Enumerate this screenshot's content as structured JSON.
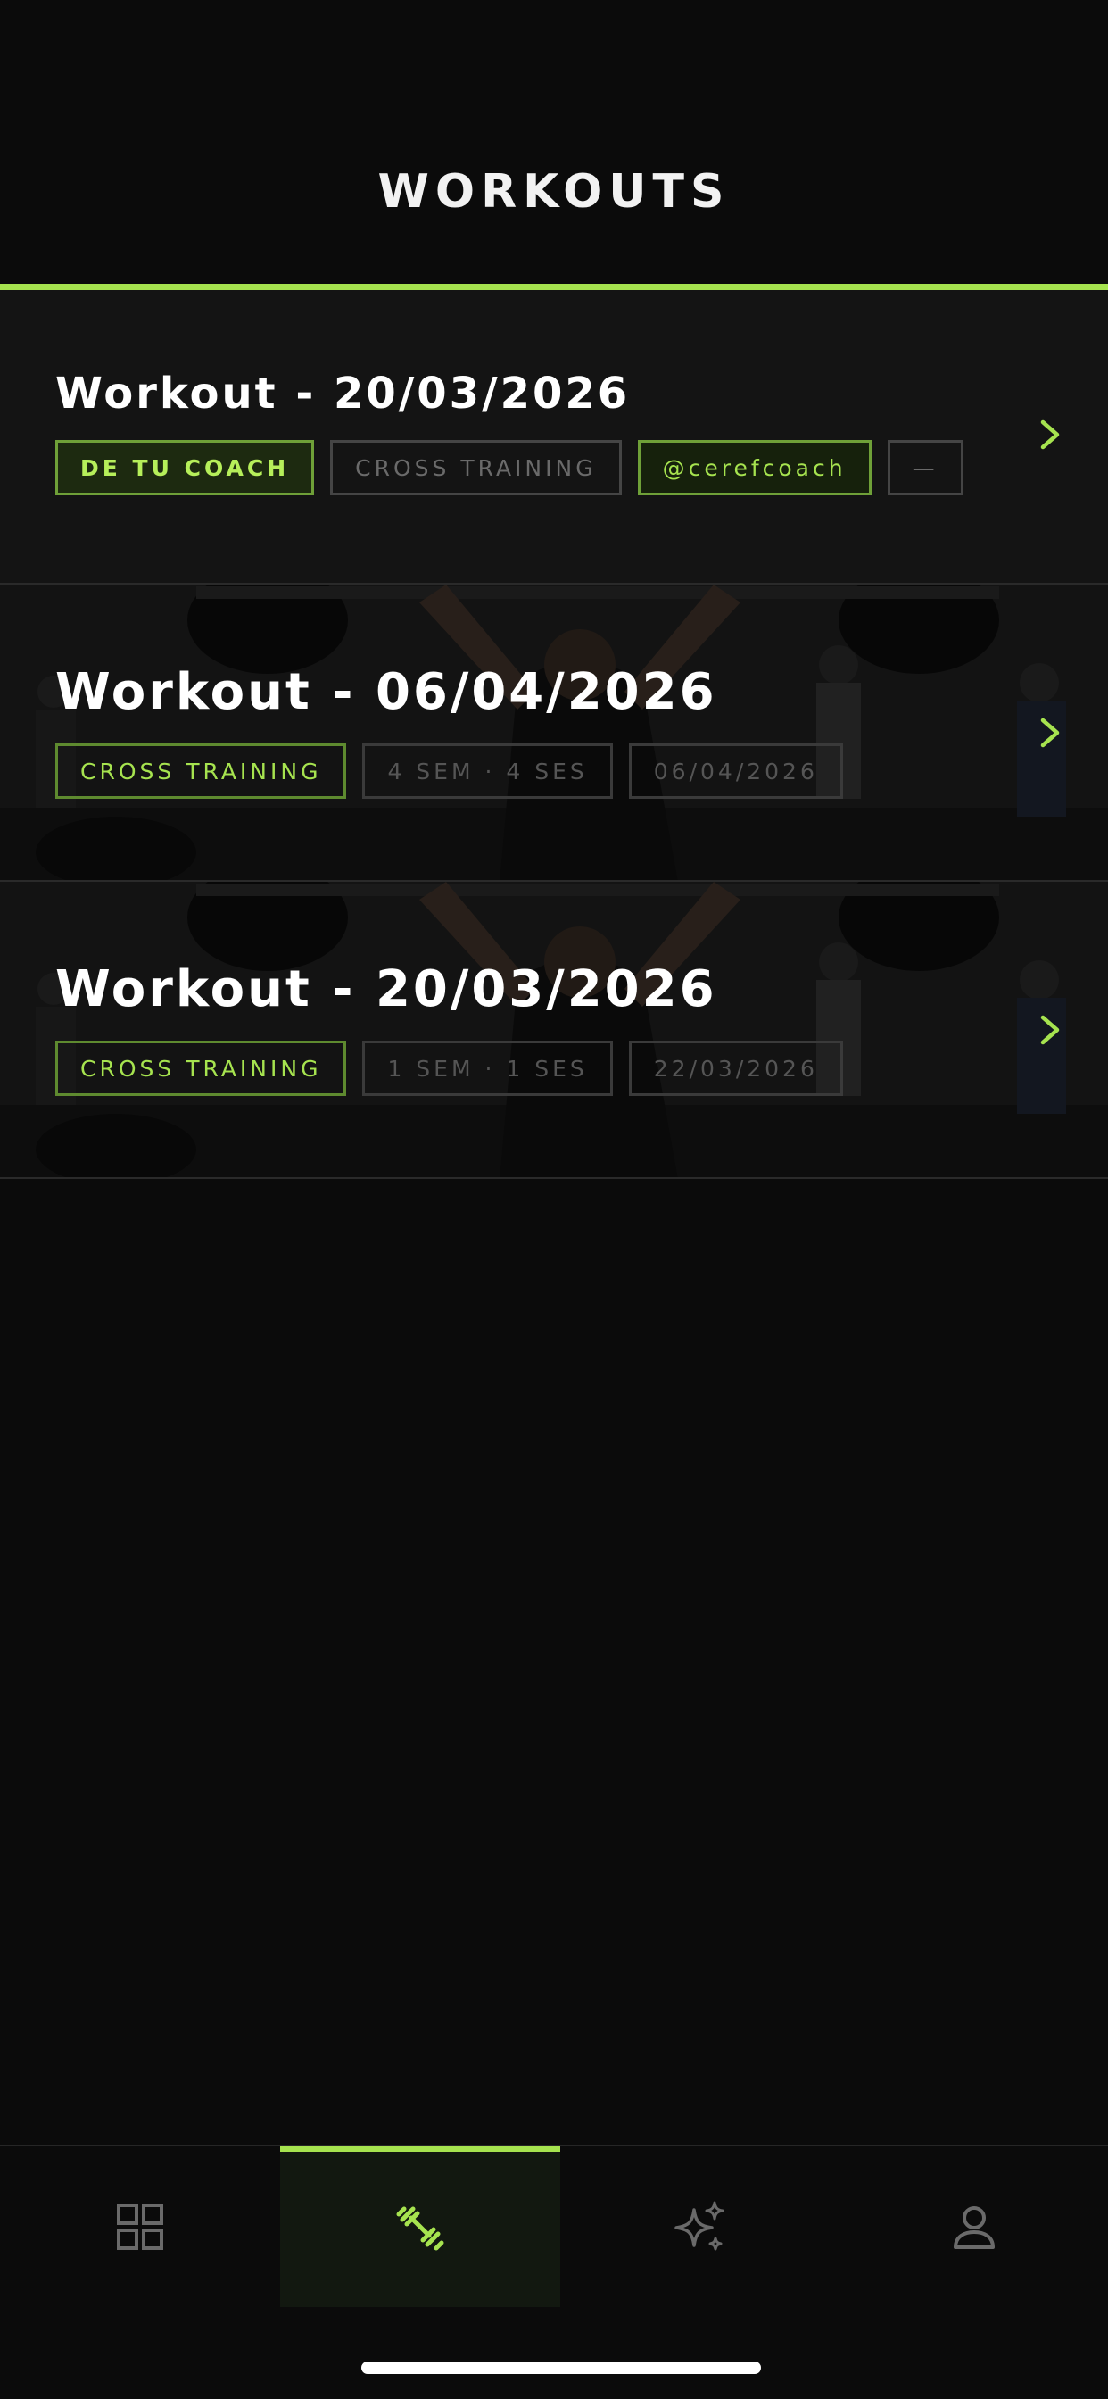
{
  "header": {
    "title": "WORKOUTS"
  },
  "workouts": [
    {
      "title": "Workout - 20/03/2026",
      "tags": [
        "DE TU COACH",
        "CROSS TRAINING",
        "@cerefcoach",
        "—"
      ]
    },
    {
      "title": "Workout - 06/04/2026",
      "tags": [
        "CROSS TRAINING",
        "4 SEM · 4 SES",
        "06/04/2026"
      ]
    },
    {
      "title": "Workout - 20/03/2026",
      "tags": [
        "CROSS TRAINING",
        "1 SEM · 1 SES",
        "22/03/2026"
      ]
    }
  ],
  "nav": {
    "items": [
      {
        "icon": "grid-icon",
        "active": false
      },
      {
        "icon": "dumbbell-icon",
        "active": true
      },
      {
        "icon": "sparkles-icon",
        "active": false
      },
      {
        "icon": "user-icon",
        "active": false
      }
    ]
  },
  "colors": {
    "accent": "#a6e34f",
    "background": "#0b0b0b",
    "card": "#141414"
  }
}
